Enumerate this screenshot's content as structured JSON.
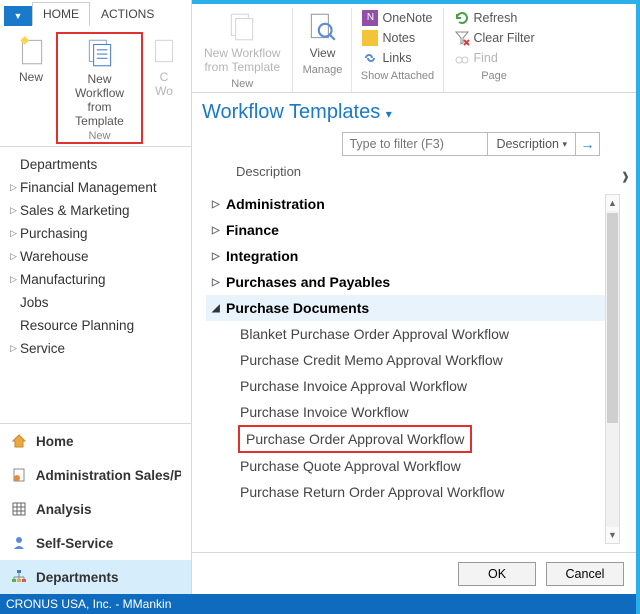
{
  "tabs": {
    "home": "HOME",
    "actions": "ACTIONS"
  },
  "ribbon_left": {
    "new": "New",
    "new_workflow_line1": "New Workflow",
    "new_workflow_line2": "from Template",
    "group": "New",
    "cut1": "C",
    "cut2": "Wo"
  },
  "ribbon_right": {
    "nwt1": "New Workflow",
    "nwt2": "from Template",
    "grp_new": "New",
    "view": "View",
    "grp_manage": "Manage",
    "onenote": "OneNote",
    "notes": "Notes",
    "links": "Links",
    "grp_show": "Show Attached",
    "refresh": "Refresh",
    "clear": "Clear Filter",
    "find": "Find",
    "grp_page": "Page"
  },
  "nav": {
    "items": [
      {
        "label": "Departments",
        "caret": ""
      },
      {
        "label": "Financial Management",
        "caret": "▷"
      },
      {
        "label": "Sales & Marketing",
        "caret": "▷"
      },
      {
        "label": "Purchasing",
        "caret": "▷"
      },
      {
        "label": "Warehouse",
        "caret": "▷"
      },
      {
        "label": "Manufacturing",
        "caret": "▷"
      },
      {
        "label": "Jobs",
        "caret": ""
      },
      {
        "label": "Resource Planning",
        "caret": ""
      },
      {
        "label": "Service",
        "caret": "▷"
      }
    ],
    "bottom": {
      "home": "Home",
      "admin": "Administration Sales/P",
      "analysis": "Analysis",
      "self": "Self-Service",
      "dept": "Departments"
    }
  },
  "page_title": "Workflow Templates",
  "filter": {
    "placeholder": "Type to filter (F3)",
    "mode": "Description"
  },
  "tree_header": "Description",
  "tree": {
    "groups": [
      {
        "label": "Administration"
      },
      {
        "label": "Finance"
      },
      {
        "label": "Integration"
      },
      {
        "label": "Purchases and Payables"
      },
      {
        "label": "Purchase Documents",
        "expanded": true,
        "children": [
          "Blanket Purchase Order Approval Workflow",
          "Purchase Credit Memo Approval Workflow",
          "Purchase Invoice Approval Workflow",
          "Purchase Invoice Workflow",
          "Purchase Order Approval Workflow",
          "Purchase Quote Approval Workflow",
          "Purchase Return Order Approval Workflow"
        ]
      }
    ]
  },
  "buttons": {
    "ok": "OK",
    "cancel": "Cancel"
  },
  "status": "CRONUS USA, Inc. - MMankin"
}
